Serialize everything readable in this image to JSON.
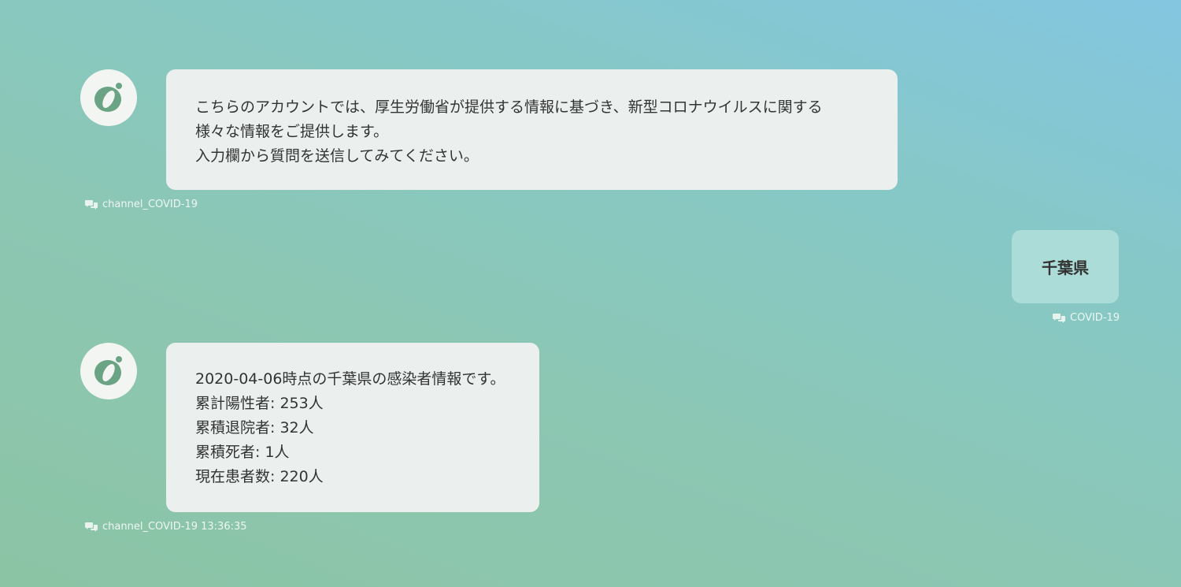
{
  "messages": [
    {
      "sender": "bot",
      "lines": [
        "こちらのアカウントでは、厚生労働省が提供する情報に基づき、新型コロナウイルスに関する",
        "様々な情報をご提供します。",
        "入力欄から質問を送信してみてください。"
      ],
      "meta": "channel_COVID-19"
    },
    {
      "sender": "user",
      "text": "千葉県",
      "meta": "COVID-19"
    },
    {
      "sender": "bot",
      "lines": [
        "2020-04-06時点の千葉県の感染者情報です。",
        "累計陽性者: 253人",
        "累積退院者: 32人",
        "累積死者: 1人",
        "現在患者数: 220人"
      ],
      "meta": "channel_COVID-19 13:36:35"
    }
  ],
  "icons": {
    "avatar": "bot-logo-icon",
    "meta": "chat-bubbles-icon"
  },
  "colors": {
    "bot_bubble": "#ebf0ef",
    "user_bubble": "#acdcd8",
    "logo_green": "#6aa485"
  }
}
